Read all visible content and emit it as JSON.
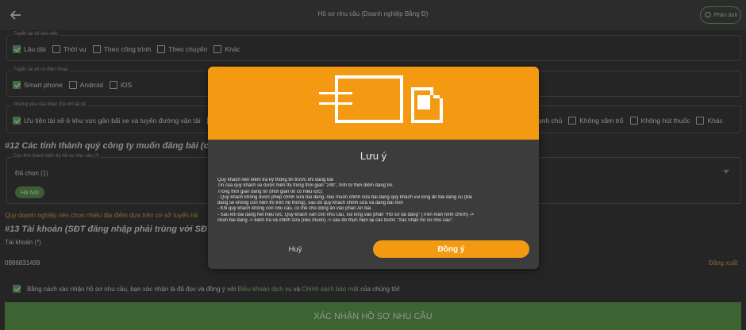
{
  "header": {
    "title": "Hồ sơ nhu cầu (Doanh nghiệp Bằng Đ)",
    "feedback_label": "Phản ánh",
    "back_icon": "arrow-left-icon"
  },
  "job_type": {
    "legend": "Tuyển tài xế làm việc",
    "options": [
      {
        "label": "Lâu dài",
        "checked": true
      },
      {
        "label": "Thời vụ",
        "checked": false
      },
      {
        "label": "Theo công trình",
        "checked": false
      },
      {
        "label": "Theo chuyến",
        "checked": false
      },
      {
        "label": "Khác",
        "checked": false
      }
    ]
  },
  "phone": {
    "legend": "Tuyển tài xế có điện thoại",
    "options": [
      {
        "label": "Smart phone",
        "checked": true
      },
      {
        "label": "Android",
        "checked": false
      },
      {
        "label": "iOS",
        "checked": false
      }
    ]
  },
  "other_req": {
    "legend": "Những yêu cầu khác đối với tài xế",
    "first_label": "Ưu tiên tài xế ở khu vực gần bãi xe và tuyến đường vận tải",
    "right_options": [
      {
        "label": "ạnh chủ",
        "checked": false
      },
      {
        "label": "Không xăm trổ",
        "checked": false
      },
      {
        "label": "Không hút thuốc",
        "checked": false
      },
      {
        "label": "Khác",
        "checked": false
      }
    ]
  },
  "section12": {
    "title": "#12 Các tỉnh thành quý công ty muốn đăng bài (chọn",
    "legend": "Các tỉnh thành hiển thị hồ sơ nhu cầu (*)",
    "selected_text": "Đã chọn (1)",
    "chip": "Hà Nội",
    "note": "Quý doanh nghiệp nên chọn nhiều địa điểm dựa trên cơ sở tuyển hả"
  },
  "section13": {
    "title": "#13 Tài khoản (SĐT đăng nhập phải trùng với SĐT liê",
    "account_label": "Tài khoản (*)",
    "account_value": "0986831499",
    "logout": "Đăng xuất"
  },
  "terms": {
    "prefix": "Bằng cách xác nhận hồ sơ nhu cầu, bạn xác nhận là đã đọc và đồng ý với ",
    "link1": "Điều khoản dịch vụ",
    "and": " và ",
    "link2": "Chính sách bảo mật",
    "suffix": " của chúng tôi!"
  },
  "confirm_button": "XÁC NHẬN HỒ SƠ NHU CẦU",
  "modal": {
    "title": "Lưu ý",
    "lines": [
      "Quý khách nên kiểm tra kỹ thông tin trước khi đăng bài",
      "Tin của quý khách sẽ được hiển thị trong thời gian \"24h\", tính từ thời điểm đăng tin.",
      "Trong thời gian đăng tin (thời gian tin có hiệu lực):",
      "- Quý khách không được phép chỉnh sửa bài đăng, nếu muốn chỉnh sửa bài đăng quý khách vui lòng ẩn bài đăng cũ (bài",
      "đăng sẽ không còn hiển thị trên hệ thống), sau đó quý khách chỉnh sửa và đăng bài mới",
      "- Khi quý khách không còn nhu cầu, có thể chủ động ẩn vào phần Ẩn bài.",
      "- Sau khi bài đăng hết hiệu lực, Quý khách vẫn còn nhu cầu, vui lòng vào phần \"Hồ sơ đã đăng\" (Trên màn hình chính) ->",
      "chọn bài đăng -> kiểm tra và chỉnh sửa (nếu muốn) -> sau đó thực hiện lại các bước \"Xác nhận hồ sơ nhu cầu\"."
    ],
    "cancel": "Huỷ",
    "ok": "Đồng ý"
  }
}
